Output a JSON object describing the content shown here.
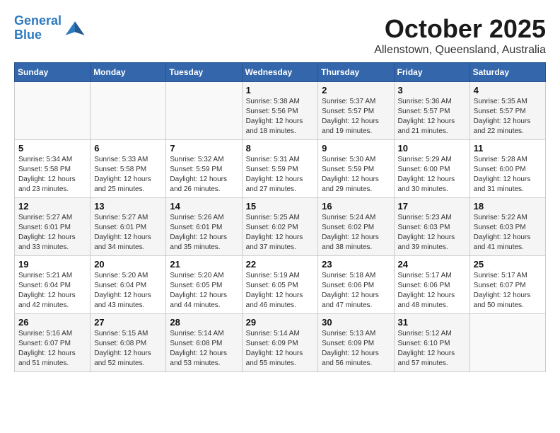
{
  "header": {
    "logo_line1": "General",
    "logo_line2": "Blue",
    "title": "October 2025",
    "subtitle": "Allenstown, Queensland, Australia"
  },
  "weekdays": [
    "Sunday",
    "Monday",
    "Tuesday",
    "Wednesday",
    "Thursday",
    "Friday",
    "Saturday"
  ],
  "weeks": [
    [
      {
        "day": "",
        "info": ""
      },
      {
        "day": "",
        "info": ""
      },
      {
        "day": "",
        "info": ""
      },
      {
        "day": "1",
        "info": "Sunrise: 5:38 AM\nSunset: 5:56 PM\nDaylight: 12 hours\nand 18 minutes."
      },
      {
        "day": "2",
        "info": "Sunrise: 5:37 AM\nSunset: 5:57 PM\nDaylight: 12 hours\nand 19 minutes."
      },
      {
        "day": "3",
        "info": "Sunrise: 5:36 AM\nSunset: 5:57 PM\nDaylight: 12 hours\nand 21 minutes."
      },
      {
        "day": "4",
        "info": "Sunrise: 5:35 AM\nSunset: 5:57 PM\nDaylight: 12 hours\nand 22 minutes."
      }
    ],
    [
      {
        "day": "5",
        "info": "Sunrise: 5:34 AM\nSunset: 5:58 PM\nDaylight: 12 hours\nand 23 minutes."
      },
      {
        "day": "6",
        "info": "Sunrise: 5:33 AM\nSunset: 5:58 PM\nDaylight: 12 hours\nand 25 minutes."
      },
      {
        "day": "7",
        "info": "Sunrise: 5:32 AM\nSunset: 5:59 PM\nDaylight: 12 hours\nand 26 minutes."
      },
      {
        "day": "8",
        "info": "Sunrise: 5:31 AM\nSunset: 5:59 PM\nDaylight: 12 hours\nand 27 minutes."
      },
      {
        "day": "9",
        "info": "Sunrise: 5:30 AM\nSunset: 5:59 PM\nDaylight: 12 hours\nand 29 minutes."
      },
      {
        "day": "10",
        "info": "Sunrise: 5:29 AM\nSunset: 6:00 PM\nDaylight: 12 hours\nand 30 minutes."
      },
      {
        "day": "11",
        "info": "Sunrise: 5:28 AM\nSunset: 6:00 PM\nDaylight: 12 hours\nand 31 minutes."
      }
    ],
    [
      {
        "day": "12",
        "info": "Sunrise: 5:27 AM\nSunset: 6:01 PM\nDaylight: 12 hours\nand 33 minutes."
      },
      {
        "day": "13",
        "info": "Sunrise: 5:27 AM\nSunset: 6:01 PM\nDaylight: 12 hours\nand 34 minutes."
      },
      {
        "day": "14",
        "info": "Sunrise: 5:26 AM\nSunset: 6:01 PM\nDaylight: 12 hours\nand 35 minutes."
      },
      {
        "day": "15",
        "info": "Sunrise: 5:25 AM\nSunset: 6:02 PM\nDaylight: 12 hours\nand 37 minutes."
      },
      {
        "day": "16",
        "info": "Sunrise: 5:24 AM\nSunset: 6:02 PM\nDaylight: 12 hours\nand 38 minutes."
      },
      {
        "day": "17",
        "info": "Sunrise: 5:23 AM\nSunset: 6:03 PM\nDaylight: 12 hours\nand 39 minutes."
      },
      {
        "day": "18",
        "info": "Sunrise: 5:22 AM\nSunset: 6:03 PM\nDaylight: 12 hours\nand 41 minutes."
      }
    ],
    [
      {
        "day": "19",
        "info": "Sunrise: 5:21 AM\nSunset: 6:04 PM\nDaylight: 12 hours\nand 42 minutes."
      },
      {
        "day": "20",
        "info": "Sunrise: 5:20 AM\nSunset: 6:04 PM\nDaylight: 12 hours\nand 43 minutes."
      },
      {
        "day": "21",
        "info": "Sunrise: 5:20 AM\nSunset: 6:05 PM\nDaylight: 12 hours\nand 44 minutes."
      },
      {
        "day": "22",
        "info": "Sunrise: 5:19 AM\nSunset: 6:05 PM\nDaylight: 12 hours\nand 46 minutes."
      },
      {
        "day": "23",
        "info": "Sunrise: 5:18 AM\nSunset: 6:06 PM\nDaylight: 12 hours\nand 47 minutes."
      },
      {
        "day": "24",
        "info": "Sunrise: 5:17 AM\nSunset: 6:06 PM\nDaylight: 12 hours\nand 48 minutes."
      },
      {
        "day": "25",
        "info": "Sunrise: 5:17 AM\nSunset: 6:07 PM\nDaylight: 12 hours\nand 50 minutes."
      }
    ],
    [
      {
        "day": "26",
        "info": "Sunrise: 5:16 AM\nSunset: 6:07 PM\nDaylight: 12 hours\nand 51 minutes."
      },
      {
        "day": "27",
        "info": "Sunrise: 5:15 AM\nSunset: 6:08 PM\nDaylight: 12 hours\nand 52 minutes."
      },
      {
        "day": "28",
        "info": "Sunrise: 5:14 AM\nSunset: 6:08 PM\nDaylight: 12 hours\nand 53 minutes."
      },
      {
        "day": "29",
        "info": "Sunrise: 5:14 AM\nSunset: 6:09 PM\nDaylight: 12 hours\nand 55 minutes."
      },
      {
        "day": "30",
        "info": "Sunrise: 5:13 AM\nSunset: 6:09 PM\nDaylight: 12 hours\nand 56 minutes."
      },
      {
        "day": "31",
        "info": "Sunrise: 5:12 AM\nSunset: 6:10 PM\nDaylight: 12 hours\nand 57 minutes."
      },
      {
        "day": "",
        "info": ""
      }
    ]
  ]
}
